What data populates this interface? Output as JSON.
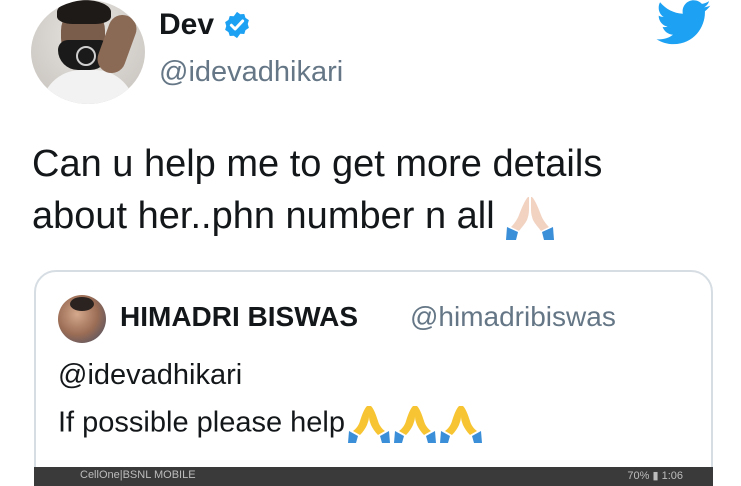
{
  "author": {
    "name": "Dev",
    "handle": "@idevadhikari",
    "verified": true
  },
  "tweet": {
    "line1": "Can u help me to get more details",
    "line2": "about her..phn number n all"
  },
  "quoted_tweet": {
    "author_name": "HIMADRI BISWAS",
    "author_handle": "@himadribiswas",
    "mention": "@idevadhikari",
    "text": "If possible please help"
  },
  "status_bar": {
    "carrier": "CellOne|BSNL MOBILE",
    "right": "70% ▮ 1:06"
  },
  "colors": {
    "twitter_blue": "#1da1f2",
    "text": "#14171a",
    "secondary": "#657786",
    "border": "#d6dde3",
    "pray_emoji_light": "#f2d3c2",
    "pray_emoji_yellow": "#f7c533",
    "sleeve_blue": "#3b8fd9"
  },
  "icons": {
    "verified": "verified-badge-icon",
    "twitter": "twitter-bird-icon",
    "pray": "folded-hands-emoji"
  }
}
